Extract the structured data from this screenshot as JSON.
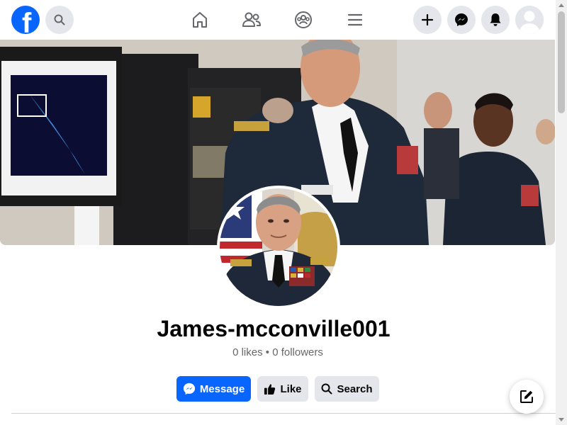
{
  "nav": {
    "logo_icon": "facebook-logo-icon",
    "logo_glyph": "f",
    "brand_color": "#0866ff",
    "search_icon": "search-icon",
    "center_icons": [
      "home-icon",
      "friends-icon",
      "groups-icon",
      "menu-icon"
    ],
    "right_icons": [
      "plus-icon",
      "messenger-icon",
      "notifications-icon",
      "avatar-icon"
    ]
  },
  "page": {
    "name": "James-mcconville001",
    "stats": "0 likes • 0 followers"
  },
  "actions": {
    "message_label": "Message",
    "like_label": "Like",
    "search_label": "Search"
  },
  "fab_icon": "compose-icon"
}
